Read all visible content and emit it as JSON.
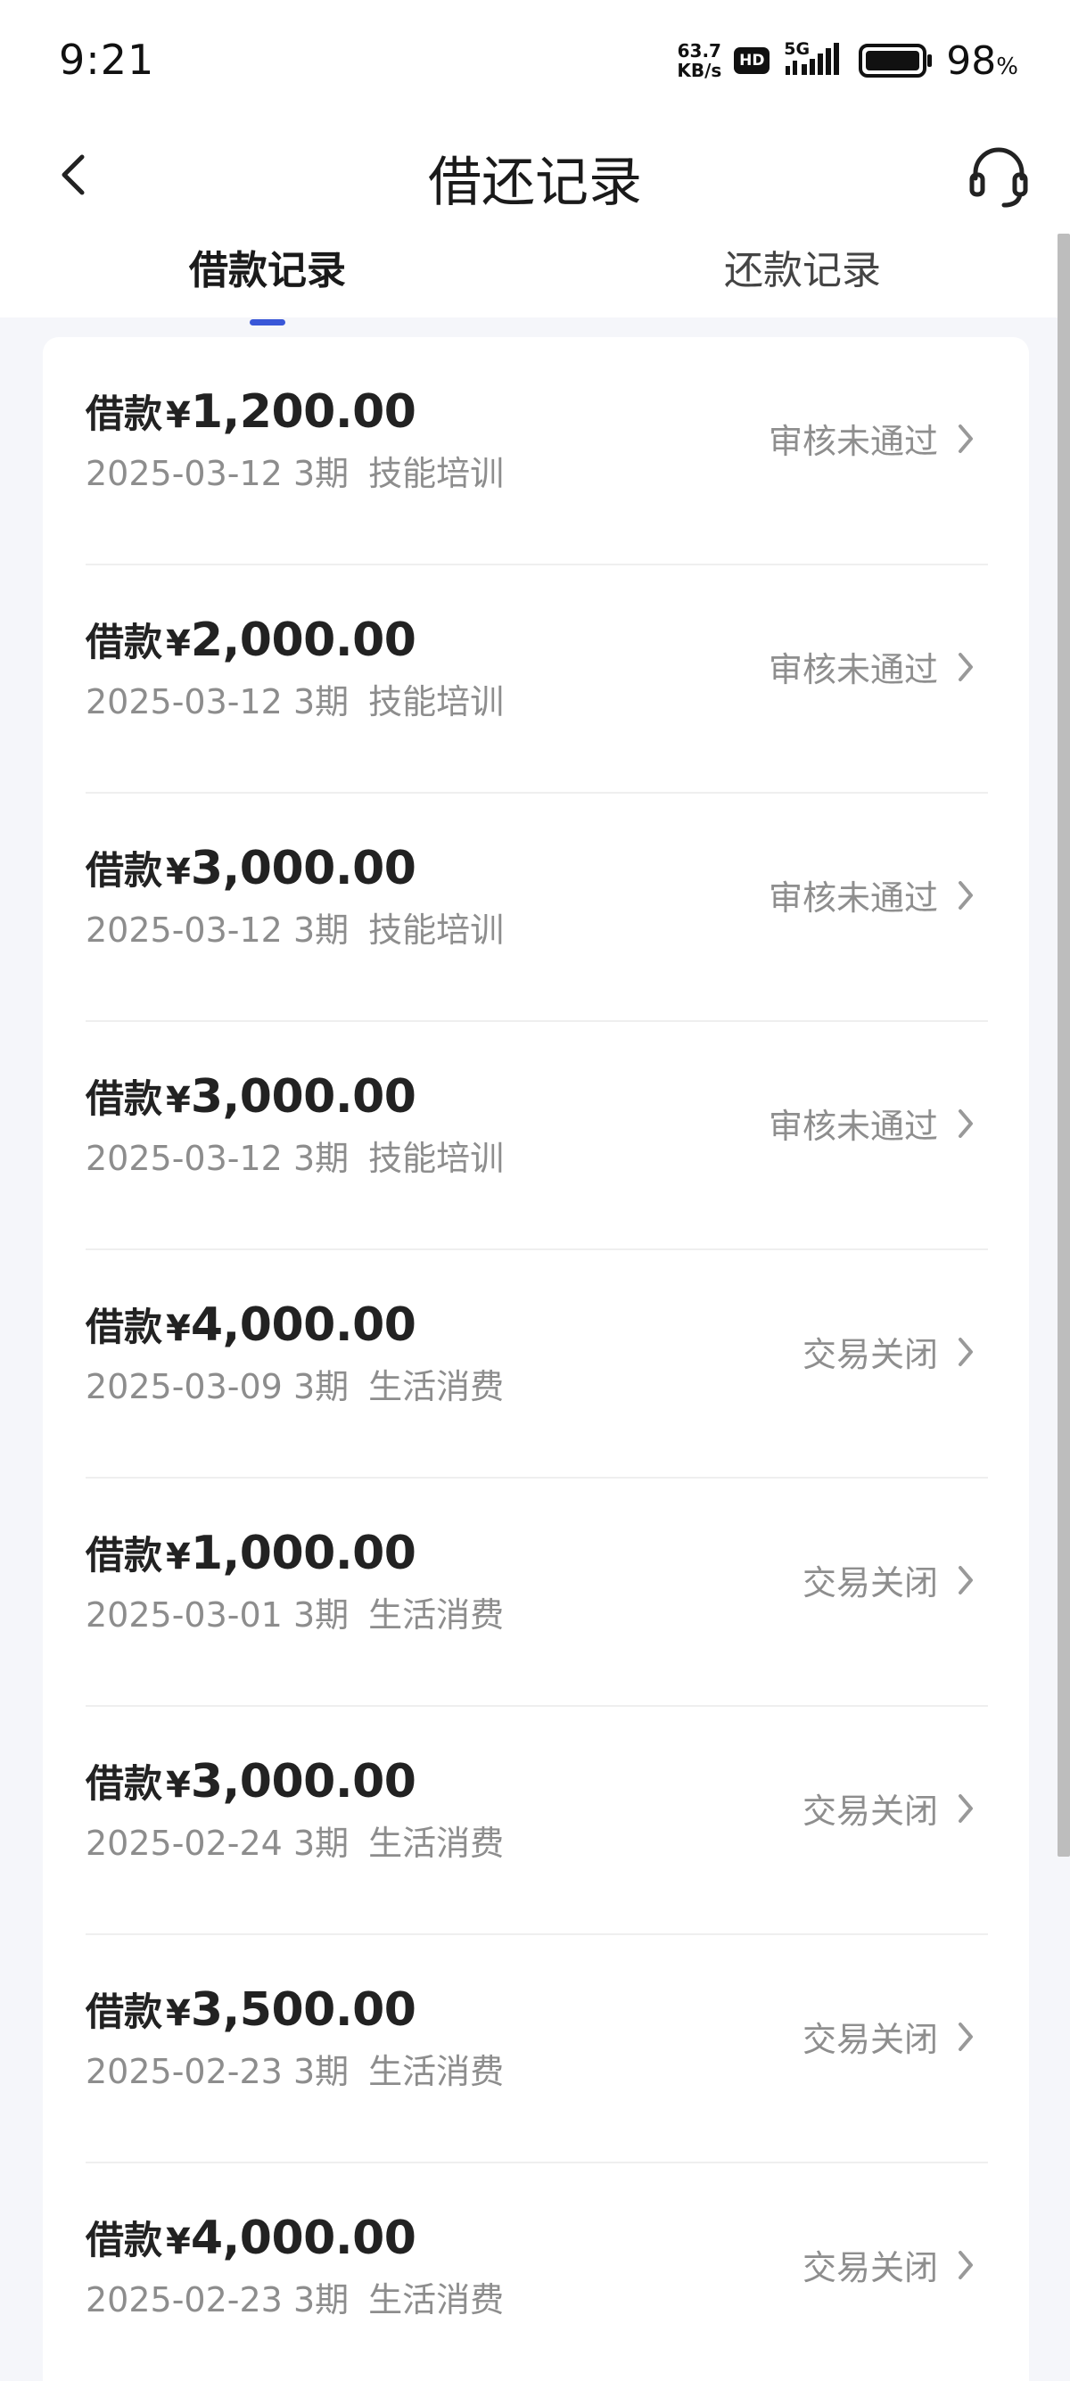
{
  "status_bar": {
    "time": "9:21",
    "net_speed_value": "63.7",
    "net_speed_unit": "KB/s",
    "hd_badge": "HD",
    "network": "5G",
    "battery_percent": "98",
    "battery_symbol": "%"
  },
  "header": {
    "title": "借还记录",
    "back_icon": "chevron-left-icon",
    "service_icon": "headset-icon"
  },
  "tabs": [
    {
      "label": "借款记录",
      "active": true
    },
    {
      "label": "还款记录",
      "active": false
    }
  ],
  "records": [
    {
      "label": "借款",
      "currency": "¥",
      "amount": "1,200.00",
      "date": "2025-03-12",
      "term": "3期",
      "category": "技能培训",
      "status": "审核未通过"
    },
    {
      "label": "借款",
      "currency": "¥",
      "amount": "2,000.00",
      "date": "2025-03-12",
      "term": "3期",
      "category": "技能培训",
      "status": "审核未通过"
    },
    {
      "label": "借款",
      "currency": "¥",
      "amount": "3,000.00",
      "date": "2025-03-12",
      "term": "3期",
      "category": "技能培训",
      "status": "审核未通过"
    },
    {
      "label": "借款",
      "currency": "¥",
      "amount": "3,000.00",
      "date": "2025-03-12",
      "term": "3期",
      "category": "技能培训",
      "status": "审核未通过"
    },
    {
      "label": "借款",
      "currency": "¥",
      "amount": "4,000.00",
      "date": "2025-03-09",
      "term": "3期",
      "category": "生活消费",
      "status": "交易关闭"
    },
    {
      "label": "借款",
      "currency": "¥",
      "amount": "1,000.00",
      "date": "2025-03-01",
      "term": "3期",
      "category": "生活消费",
      "status": "交易关闭"
    },
    {
      "label": "借款",
      "currency": "¥",
      "amount": "3,000.00",
      "date": "2025-02-24",
      "term": "3期",
      "category": "生活消费",
      "status": "交易关闭"
    },
    {
      "label": "借款",
      "currency": "¥",
      "amount": "3,500.00",
      "date": "2025-02-23",
      "term": "3期",
      "category": "生活消费",
      "status": "交易关闭"
    },
    {
      "label": "借款",
      "currency": "¥",
      "amount": "4,000.00",
      "date": "2025-02-23",
      "term": "3期",
      "category": "生活消费",
      "status": "交易关闭"
    }
  ],
  "colors": {
    "accent": "#3957d8",
    "page_bg": "#f5f6fa",
    "status_text": "#8e8e8e"
  }
}
